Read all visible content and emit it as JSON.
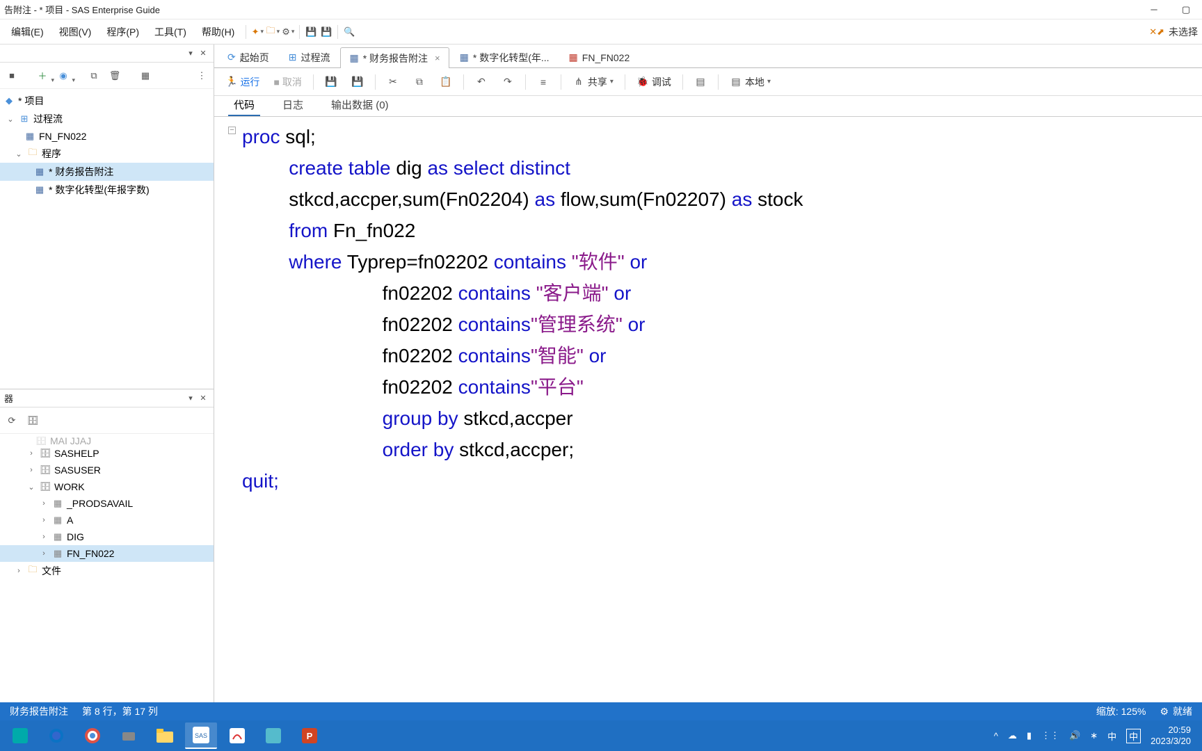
{
  "window": {
    "title": "告附注 - * 项目 - SAS Enterprise Guide"
  },
  "menu": {
    "edit": "编辑(E)",
    "view": "视图(V)",
    "program": "程序(P)",
    "tools": "工具(T)",
    "help": "帮助(H)",
    "unselected": "未选择"
  },
  "projectPane": {
    "title": "",
    "root": "* 项目",
    "flow": "过程流",
    "fn": "FN_FN022",
    "programs": "程序",
    "p1": "* 财务报告附注",
    "p2": "* 数字化转型(年报字数)"
  },
  "serverPane": {
    "title": "器",
    "cut_item": "MAI JJAJ",
    "sashelp": "SASHELP",
    "sasuser": "SASUSER",
    "work": "WORK",
    "prodsavail": "_PRODSAVAIL",
    "a": "A",
    "dig": "DIG",
    "fnfn022": "FN_FN022",
    "files": "文件"
  },
  "tabs": {
    "start": "起始页",
    "flow": "过程流",
    "t1": "* 财务报告附注",
    "t2": "* 数字化转型(年...",
    "t3": "FN_FN022"
  },
  "editbar": {
    "run": "运行",
    "cancel": "取消",
    "share": "共享",
    "debug": "调试",
    "local": "本地"
  },
  "subtabs": {
    "code": "代码",
    "log": "日志",
    "output": "输出数据 (0)"
  },
  "code": {
    "l1a": "proc",
    "l1b": " sql;",
    "l2a": "create",
    "l2b": " ",
    "l2c": "table",
    "l2d": " dig ",
    "l2e": "as",
    "l2f": " ",
    "l2g": "select",
    "l2h": " ",
    "l2i": "distinct",
    "l3a": "stkcd,accper,sum(Fn02204) ",
    "l3b": "as",
    "l3c": " flow,sum(Fn02207) ",
    "l3d": "as",
    "l3e": " stock",
    "l4a": "from",
    "l4b": " Fn_fn022",
    "l5a": "where",
    "l5b": " Typrep=",
    "l5c": "fn02202 ",
    "l5d": "contains",
    "l5e": " ",
    "l5f": "\"软件\"",
    "l5g": " ",
    "l5h": "or",
    "l6a": "fn02202 ",
    "l6b": "contains",
    "l6c": " ",
    "l6d": "\"客户端\"",
    "l6e": " ",
    "l6f": "or",
    "l7a": "fn02202 ",
    "l7b": "contains",
    "l7c": "\"管理系统\"",
    "l7d": " ",
    "l7e": "or",
    "l8a": "fn02202 ",
    "l8b": "contains",
    "l8c": "\"智能\"",
    "l8d": " ",
    "l8e": "or",
    "l9a": "fn02202 ",
    "l9b": "contains",
    "l9c": "\"平台\"",
    "l10a": "group",
    "l10b": " ",
    "l10c": "by",
    "l10d": " stkcd,accper",
    "l11a": "order",
    "l11b": " ",
    "l11c": "by",
    "l11d": " stkcd,accper;",
    "l12": "quit;"
  },
  "status": {
    "file": "财务报告附注",
    "pos": "第 8 行，第 17 列",
    "zoom": "缩放: 125%",
    "ready": "就绪"
  },
  "tray": {
    "ime1": "中",
    "ime2": "中",
    "time": "20:59",
    "date": "2023/3/20"
  }
}
